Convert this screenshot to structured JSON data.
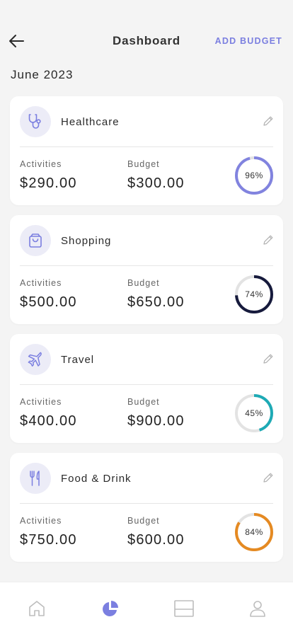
{
  "header": {
    "title": "Dashboard",
    "add_budget_label": "ADD BUDGET",
    "back_icon": "arrow-left-icon"
  },
  "month_label": "June 2023",
  "labels": {
    "activities": "Activities",
    "budget": "Budget"
  },
  "budgets": [
    {
      "name": "Healthcare",
      "icon": "stethoscope-icon",
      "activities": "$290.00",
      "budget": "$300.00",
      "percent": 96,
      "percent_label": "96%",
      "color": "#8183df"
    },
    {
      "name": "Shopping",
      "icon": "shopping-bag-icon",
      "activities": "$500.00",
      "budget": "$650.00",
      "percent": 74,
      "percent_label": "74%",
      "color": "#161a3c"
    },
    {
      "name": "Travel",
      "icon": "airplane-icon",
      "activities": "$400.00",
      "budget": "$900.00",
      "percent": 45,
      "percent_label": "45%",
      "color": "#1eaab5"
    },
    {
      "name": "Food & Drink",
      "icon": "fork-knife-icon",
      "activities": "$750.00",
      "budget": "$600.00",
      "percent": 84,
      "percent_label": "84%",
      "color": "#e58a22"
    }
  ],
  "colors": {
    "accent": "#7b7fe0",
    "icon_bg": "#ececf7",
    "ring_track": "#e3e3e3",
    "nav_inactive": "#bdbdbd",
    "nav_active": "#7b7fe0"
  },
  "bottom_nav": [
    {
      "icon": "home-icon",
      "active": false
    },
    {
      "icon": "pie-chart-icon",
      "active": true
    },
    {
      "icon": "card-icon",
      "active": false
    },
    {
      "icon": "profile-icon",
      "active": false
    }
  ]
}
